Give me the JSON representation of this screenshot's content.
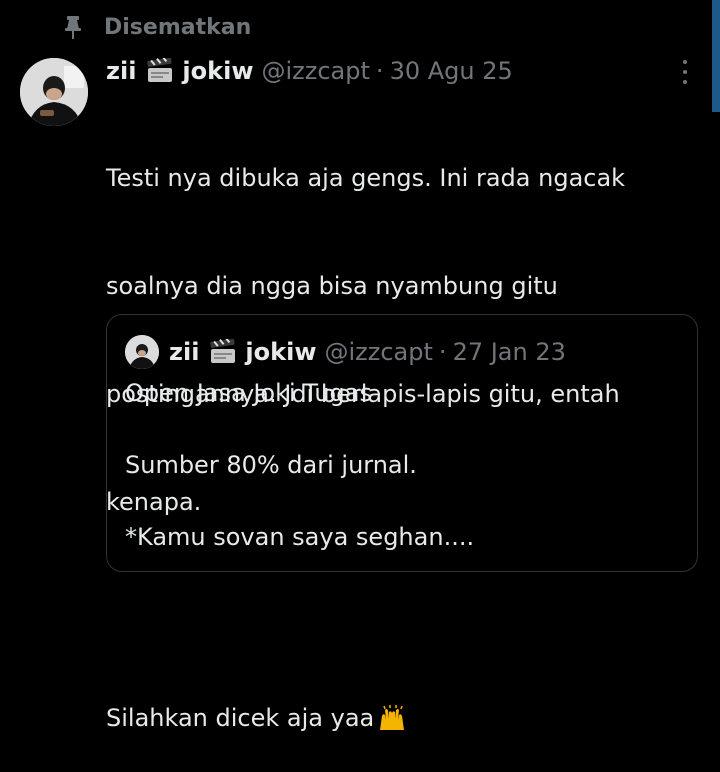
{
  "pinned": {
    "label": "Disematkan",
    "icon": "pin-icon"
  },
  "tweet": {
    "name": "zii",
    "name_suffix": "jokiw",
    "handle": "@izzcapt",
    "separator": "·",
    "date": "30 Agu 25",
    "lines": [
      "Testi nya dibuka aja gengs. Ini rada ngacak",
      "soalnya dia ngga bisa nyambung gitu",
      "postingannya. Jdi berlapis-lapis gitu, entah",
      "kenapa.",
      "",
      "Silahkan dicek aja yaa"
    ],
    "emoji": "raising-hands-emoji"
  },
  "quote": {
    "name": "zii",
    "name_suffix": "jokiw",
    "handle": "@izzcapt",
    "separator": "·",
    "date": "27 Jan 23",
    "lines": [
      "Open Jasa Joki Tugas",
      "",
      "Sumber 80% dari jurnal.",
      "",
      "*Kamu sovan saya seghan...."
    ]
  },
  "colors": {
    "background": "#000000",
    "text": "#e7e9ea",
    "secondary": "#71767b",
    "border": "#2f3336",
    "scrollbar": "#1d5a8a"
  }
}
